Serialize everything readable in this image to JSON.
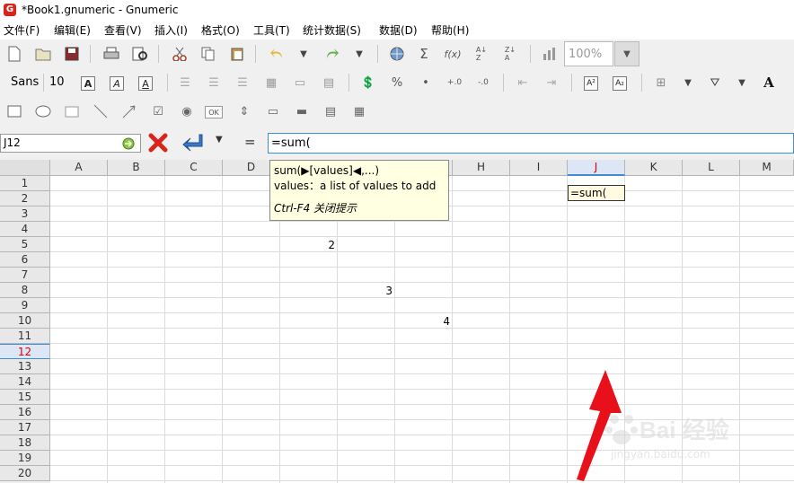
{
  "window": {
    "title": "*Book1.gnumeric - Gnumeric"
  },
  "menu": [
    "文件(F)",
    "编辑(E)",
    "查看(V)",
    "插入(I)",
    "格式(O)",
    "工具(T)",
    "统计数据(S)",
    "数据(D)",
    "帮助(H)"
  ],
  "toolbar": {
    "zoom_value": "100%",
    "font_name": "Sans",
    "font_size": "10",
    "superscript_label": "A²",
    "subscript_label": "A₂",
    "font_color_label": "A",
    "button_label": "OK",
    "function_icon": "f(x)",
    "sum_icon": "Σ",
    "percent_icon": "%",
    "thousands_icon": "•"
  },
  "formula_bar": {
    "name_box": "J12",
    "equals_label": "=",
    "entry_value": "=sum("
  },
  "columns": [
    "A",
    "B",
    "C",
    "D",
    "E",
    "F",
    "G",
    "H",
    "I",
    "J",
    "K",
    "L",
    "M"
  ],
  "rows": [
    "1",
    "2",
    "3",
    "4",
    "5",
    "6",
    "7",
    "8",
    "9",
    "10",
    "11",
    "12",
    "13",
    "14",
    "15",
    "16",
    "17",
    "18",
    "19",
    "20"
  ],
  "active_cell": {
    "column": "J",
    "row": "12",
    "edit_text": "=sum("
  },
  "cells": {
    "row5_value": "2",
    "row8_value": "3",
    "row10_value": "4"
  },
  "tooltip": {
    "signature": "sum(▶[values]◀,...)",
    "description": "values：a list of values to add",
    "hint": "Ctrl-F4 关闭提示"
  },
  "watermark": {
    "logo": "Bai 经验",
    "url": "jingyan.baidu.com"
  },
  "colors": {
    "accent": "#3c8fd6",
    "active_header_text": "#e00000",
    "arrow": "#e8101a",
    "tooltip_bg": "#ffffe1"
  }
}
